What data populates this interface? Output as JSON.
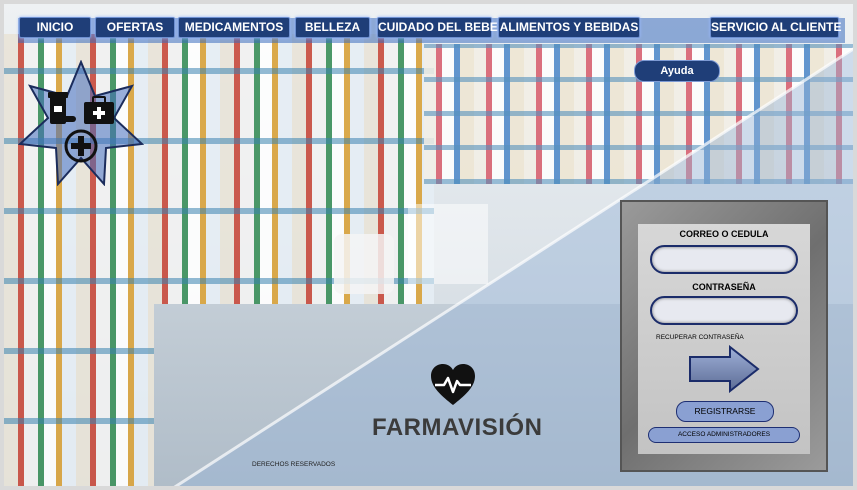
{
  "nav": {
    "items": [
      {
        "label": "INICIO"
      },
      {
        "label": "OFERTAS"
      },
      {
        "label": "MEDICAMENTOS"
      },
      {
        "label": "BELLEZA"
      },
      {
        "label": "CUIDADO DEL BEBE"
      },
      {
        "label": "ALIMENTOS Y BEBIDAS"
      }
    ],
    "service_label": "SERVICIO AL CLIENTE"
  },
  "help_label": "Ayuda",
  "login": {
    "email_label": "CORREO O CEDULA",
    "password_label": "CONTRASEÑA",
    "recover_label": "RECUPERAR CONTRASEÑA",
    "register_label": "REGISTRARSE",
    "admin_label": "ACCESO ADMINISTRADORES"
  },
  "brand": {
    "name": "FARMAVISIÓN"
  },
  "footer": {
    "rights": "DERECHOS RESERVADOS"
  },
  "colors": {
    "nav_button": "#1f3e78",
    "panel": "#7a7a7a",
    "pill": "#8aa0d2",
    "arrow_fill": "#7f8fb8"
  },
  "icons": [
    "pill-bottle-icon",
    "first-aid-kit-icon",
    "plus-cross-icon",
    "heartbeat-icon",
    "arrow-right-icon"
  ]
}
